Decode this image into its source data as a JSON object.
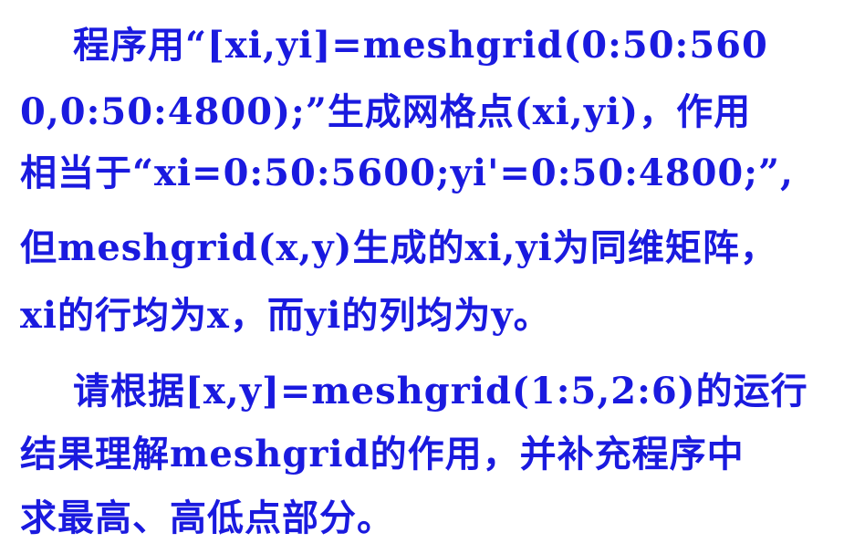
{
  "document": {
    "paragraph1": {
      "lines": [
        "程序用“[xi,yi]=meshgrid(0:50:560",
        "0,0:50:4800);”生成网格点(xi,yi)，作用",
        "相当于“xi=0:50:5600;yi'=0:50:4800;”,",
        "但meshgrid(x,y)生成的xi,yi为同维矩阵，",
        "xi的行均为x，而yi的列均为y。"
      ]
    },
    "paragraph2": {
      "lines": [
        "请根据[x,y]=meshgrid(1:5,2:6)的运行",
        "结果理解meshgrid的作用，并补充程序中",
        "求最高、高低点部分。"
      ]
    },
    "text_color": "#1a1adf"
  }
}
